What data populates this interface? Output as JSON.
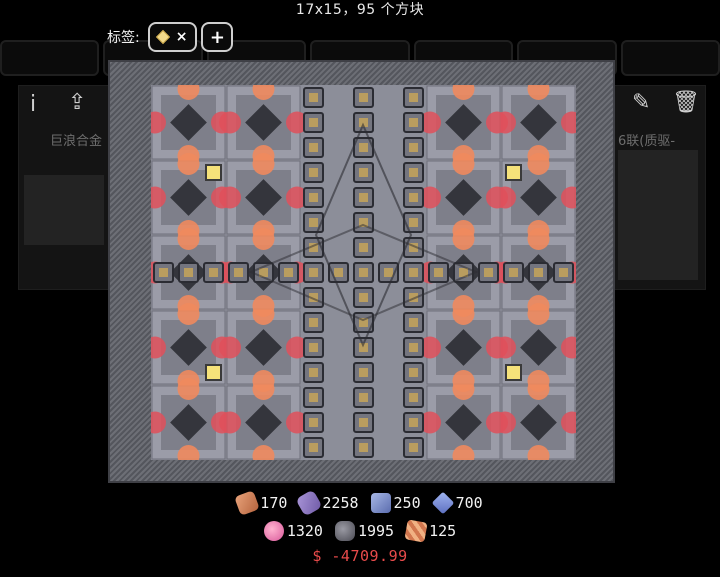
{
  "header": {
    "dimensions": "17x15，95 个方块"
  },
  "tags": {
    "label": "标签:",
    "remove_symbol": "×",
    "add_symbol": "+"
  },
  "background": {
    "left_title": "巨浪合金",
    "right_title": "6联(质驱-",
    "info_icon": "i",
    "export_icon": "⇪",
    "edit_icon": "✎",
    "delete_icon": "🗑"
  },
  "costs": [
    {
      "item": "copper",
      "value": "170"
    },
    {
      "item": "plastanium",
      "value": "2258"
    },
    {
      "item": "titanium",
      "value": "250"
    },
    {
      "item": "surge",
      "value": "700"
    },
    {
      "item": "phase",
      "value": "1320"
    },
    {
      "item": "lead",
      "value": "1995"
    },
    {
      "item": "silicon",
      "value": "125"
    }
  ],
  "money": {
    "symbol": "$",
    "value": "-4709.99"
  },
  "colors": {
    "accent_red": "#e84b4b",
    "tile_gray": "#8c8e99",
    "tile_orange": "#f08a5d",
    "tile_red": "#e0505a"
  }
}
